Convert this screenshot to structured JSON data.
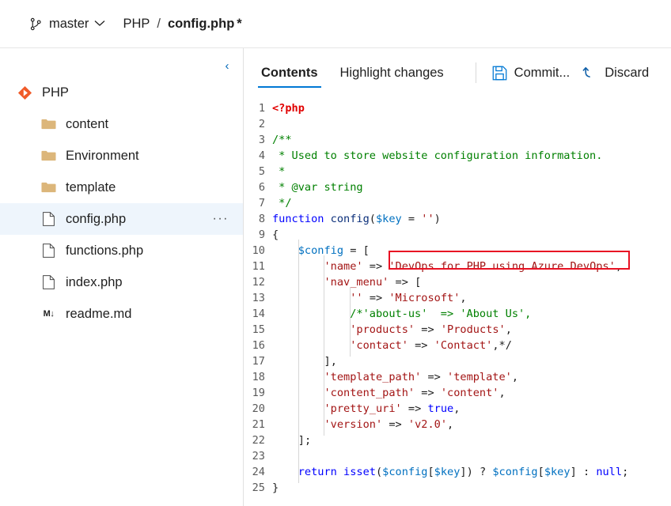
{
  "header": {
    "branch_icon": "branch-icon",
    "branch_name": "master",
    "chevron": "⌄",
    "breadcrumb_repo": "PHP",
    "breadcrumb_separator": "/",
    "breadcrumb_file": "config.php",
    "dirty_marker": "*"
  },
  "sidebar": {
    "collapse_icon": "‹",
    "repo": {
      "label": "PHP",
      "icon": "azure-repos-icon"
    },
    "items": [
      {
        "label": "content",
        "icon": "folder-icon",
        "selected": false
      },
      {
        "label": "Environment",
        "icon": "folder-icon",
        "selected": false
      },
      {
        "label": "template",
        "icon": "folder-icon",
        "selected": false
      },
      {
        "label": "config.php",
        "icon": "file-icon",
        "selected": true,
        "more": "···"
      },
      {
        "label": "functions.php",
        "icon": "file-icon",
        "selected": false
      },
      {
        "label": "index.php",
        "icon": "file-icon",
        "selected": false
      },
      {
        "label": "readme.md",
        "icon": "markdown-icon",
        "selected": false,
        "glyph": "M↓"
      }
    ]
  },
  "toolbar": {
    "tabs": [
      {
        "label": "Contents",
        "active": true
      },
      {
        "label": "Highlight changes",
        "active": false
      }
    ],
    "commit_label": "Commit...",
    "commit_icon": "save-floppy-icon",
    "discard_label": "Discard",
    "discard_icon": "undo-arrow-icon"
  },
  "highlights": {
    "commit_button_box_color": "#e81123",
    "name_value_box_color": "#e81123"
  },
  "colors": {
    "accent": "#0078d4",
    "selected_row": "#eef5fc",
    "folder": "#dcb67a",
    "repo_icon": "#f05a28",
    "keyword": "#0000ff",
    "string": "#a31515",
    "comment": "#008000",
    "variable": "#0070c0",
    "php_tag": "#e10000"
  },
  "editor": {
    "first_line": 1,
    "last_line": 25,
    "lines": [
      {
        "n": 1,
        "text": "<?php"
      },
      {
        "n": 2,
        "text": ""
      },
      {
        "n": 3,
        "text": "/**"
      },
      {
        "n": 4,
        "text": " * Used to store website configuration information."
      },
      {
        "n": 5,
        "text": " *"
      },
      {
        "n": 6,
        "text": " * @var string"
      },
      {
        "n": 7,
        "text": " */"
      },
      {
        "n": 8,
        "text": "function config($key = '')"
      },
      {
        "n": 9,
        "text": "{"
      },
      {
        "n": 10,
        "text": "    $config = ["
      },
      {
        "n": 11,
        "text": "        'name' => 'DevOps for PHP using Azure DevOps',"
      },
      {
        "n": 12,
        "text": "        'nav_menu' => ["
      },
      {
        "n": 13,
        "text": "            '' => 'Microsoft',"
      },
      {
        "n": 14,
        "text": "            /*'about-us'  => 'About Us',"
      },
      {
        "n": 15,
        "text": "            'products' => 'Products',"
      },
      {
        "n": 16,
        "text": "            'contact' => 'Contact',*/"
      },
      {
        "n": 17,
        "text": "        ],"
      },
      {
        "n": 18,
        "text": "        'template_path' => 'template',"
      },
      {
        "n": 19,
        "text": "        'content_path' => 'content',"
      },
      {
        "n": 20,
        "text": "        'pretty_uri' => true,"
      },
      {
        "n": 21,
        "text": "        'version' => 'v2.0',"
      },
      {
        "n": 22,
        "text": "    ];"
      },
      {
        "n": 23,
        "text": ""
      },
      {
        "n": 24,
        "text": "    return isset($config[$key]) ? $config[$key] : null;"
      },
      {
        "n": 25,
        "text": "}"
      }
    ]
  }
}
